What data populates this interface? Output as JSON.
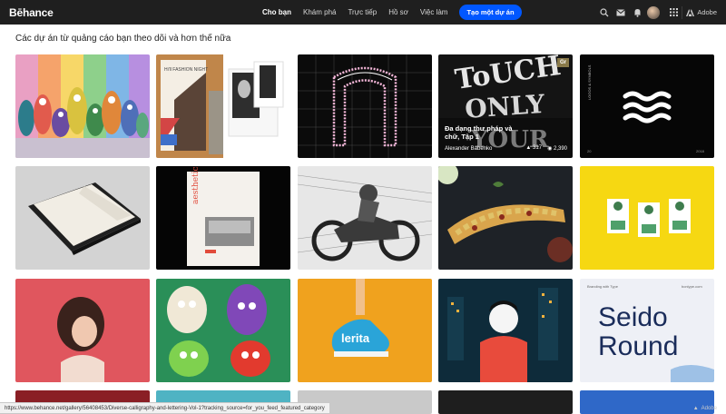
{
  "app": {
    "logo": "Bēhance"
  },
  "nav": {
    "items": [
      {
        "label": "Cho bạn",
        "active": true
      },
      {
        "label": "Khám phá",
        "active": false
      },
      {
        "label": "Trực tiếp",
        "active": false
      },
      {
        "label": "Hồ sơ",
        "active": false
      },
      {
        "label": "Việc làm",
        "active": false
      }
    ],
    "cta_label": "Tạo một dự án"
  },
  "tools": {
    "icons": [
      "search-icon",
      "mail-icon",
      "bell-icon",
      "avatar",
      "apps-grid-icon"
    ],
    "adobe_label": "Adobe"
  },
  "feed": {
    "heading": "Các dự án từ quảng cáo bạn theo dõi và hơn thế nữa",
    "featured": {
      "title": "Đa dạng thư pháp và chữ, Tập 1",
      "author": "Alexander Babenko",
      "likes": "317",
      "views": "2,390",
      "badge": "Gr"
    },
    "texts": {
      "aesthetic": "aesthetic mag.",
      "lerita": "lerita",
      "seido_line1": "Seido",
      "seido_line2": "Round",
      "logos_side": "LOGOS & SYMBOLS",
      "logos_left": "20",
      "logos_right": "2018",
      "tile_fashion": "Hi'll FASHION NIGHT",
      "branding_type": "Branding with Type",
      "seido_site": "bonlype.com"
    }
  },
  "status": {
    "url": "https://www.behance.net/gallery/56408453/Diverse-calligraphy-and-lettering-Vol-1?tracking_source=for_you_feed_featured_category"
  },
  "colors": {
    "topbar": "#1f1f1f",
    "accent": "#0057ff"
  }
}
